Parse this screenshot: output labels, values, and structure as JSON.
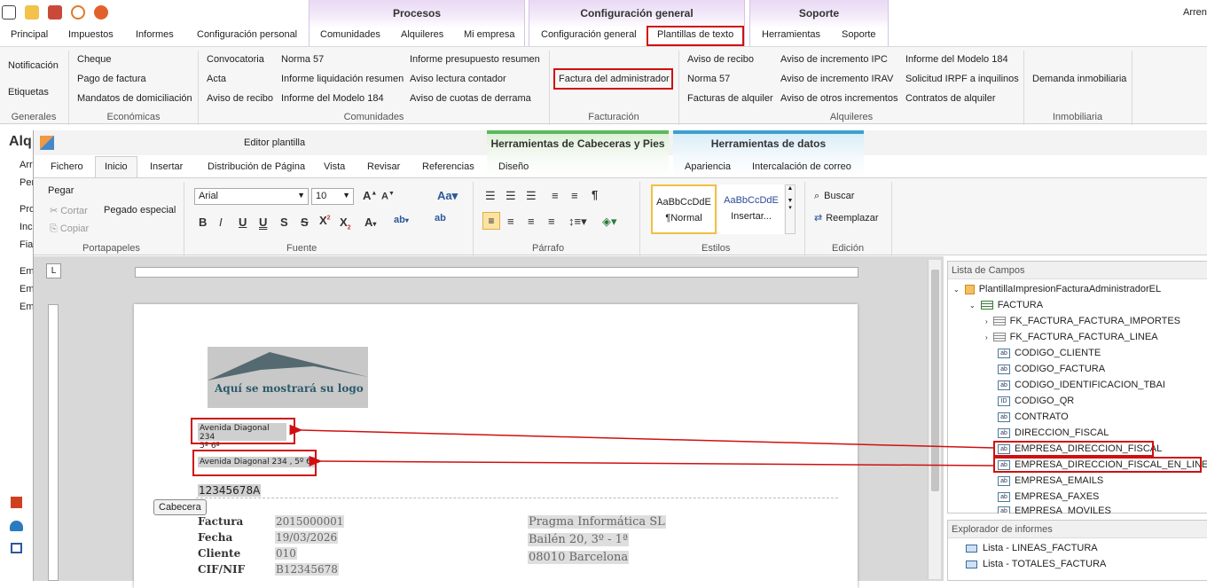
{
  "outer": {
    "user": "Arren",
    "context_groups": [
      "Procesos",
      "Configuración general",
      "Soporte"
    ],
    "tabs": [
      "Principal",
      "Impuestos",
      "Informes",
      "Configuración personal",
      "Comunidades",
      "Alquileres",
      "Mi empresa",
      "Configuración general",
      "Plantillas de texto",
      "Herramientas",
      "Soporte"
    ],
    "groups": {
      "generales": {
        "label": "Generales",
        "items": [
          "Notificación",
          "Etiquetas"
        ]
      },
      "economicas": {
        "label": "Económicas",
        "items": [
          "Cheque",
          "Pago de factura",
          "Mandatos de domiciliación"
        ]
      },
      "comunidades": {
        "label": "Comunidades",
        "items": [
          "Convocatoria",
          "Acta",
          "Aviso de recibo",
          "Norma 57",
          "Informe liquidación resumen",
          "Informe del Modelo 184",
          "Informe presupuesto resumen",
          "Aviso lectura contador",
          "Aviso de cuotas de derrama"
        ]
      },
      "facturacion": {
        "label": "Facturación",
        "items": [
          "Factura del administrador"
        ]
      },
      "alquileres": {
        "label": "Alquileres",
        "items": [
          "Aviso de recibo",
          "Norma 57",
          "Facturas de alquiler",
          "Aviso de incremento IPC",
          "Aviso de incremento IRAV",
          "Aviso de otros incrementos",
          "Informe del Modelo 184",
          "Solicitud IRPF a inquilinos",
          "Contratos de alquiler"
        ]
      },
      "inmobiliaria": {
        "label": "Inmobiliaria",
        "items": [
          "Demanda inmobiliaria"
        ]
      }
    },
    "left_partial": [
      "Alq",
      "Arr",
      "Per",
      "Pro",
      "Inc",
      "Fia",
      "Em",
      "Em",
      "Em"
    ]
  },
  "editor": {
    "title": "Editor plantilla",
    "context_groups": [
      "Herramientas de Cabeceras y Pies",
      "Herramientas de datos"
    ],
    "tabs": [
      "Fichero",
      "Inicio",
      "Insertar",
      "Distribución de Página",
      "Vista",
      "Revisar",
      "Referencias",
      "Diseño",
      "Apariencia",
      "Intercalación de correo"
    ],
    "clipboard": {
      "label": "Portapapeles",
      "paste": "Pegar",
      "cut": "Cortar",
      "copy": "Copiar",
      "paste_special": "Pegado especial"
    },
    "font": {
      "label": "Fuente",
      "family": "Arial",
      "size": "10"
    },
    "paragraph": {
      "label": "Párrafo"
    },
    "styles": {
      "label": "Estilos",
      "normal_sample": "AaBbCcDdE",
      "normal": "¶Normal",
      "insert_sample": "AaBbCcDdE",
      "insert": "Insertar..."
    },
    "edit": {
      "label": "Edición",
      "find": "Buscar",
      "replace": "Reemplazar"
    }
  },
  "document": {
    "logo_text": "Aquí se mostrará su logo",
    "address_box1_line1": "Avenida Diagonal 234",
    "address_box1_line2": "5º 6ª",
    "address_box2": "Avenida Diagonal 234 ,  5º 6ª",
    "nif_header": "12345678A",
    "header_tag": "Cabecera",
    "labels": [
      "Factura",
      "Fecha",
      "Cliente",
      "CIF/NIF"
    ],
    "values": [
      "2015000001",
      "19/03/2026",
      "010",
      "B12345678"
    ],
    "company": [
      "Pragma Informática SL",
      "Bailén 20, 3º - 1ª",
      "08010 Barcelona"
    ]
  },
  "fields_panel": {
    "title": "Lista de Campos",
    "root": "PlantillaImpresionFacturaAdministradorEL",
    "table": "FACTURA",
    "items": [
      "FK_FACTURA_FACTURA_IMPORTES",
      "FK_FACTURA_FACTURA_LINEA",
      "CODIGO_CLIENTE",
      "CODIGO_FACTURA",
      "CODIGO_IDENTIFICACION_TBAI",
      "CODIGO_QR",
      "CONTRATO",
      "DIRECCION_FISCAL",
      "EMPRESA_DIRECCION_FISCAL",
      "EMPRESA_DIRECCION_FISCAL_EN_LINEA",
      "EMPRESA_EMAILS",
      "EMPRESA_FAXES",
      "EMPRESA_MOVILES"
    ]
  },
  "reports_panel": {
    "title": "Explorador de informes",
    "items": [
      "Lista - LINEAS_FACTURA",
      "Lista - TOTALES_FACTURA"
    ]
  },
  "colors": {
    "highlight_red": "#d01010",
    "procesos_tint": "#e9d8f4",
    "cab_tint": "#5cb85c",
    "datos_tint": "#3ca0d0"
  }
}
